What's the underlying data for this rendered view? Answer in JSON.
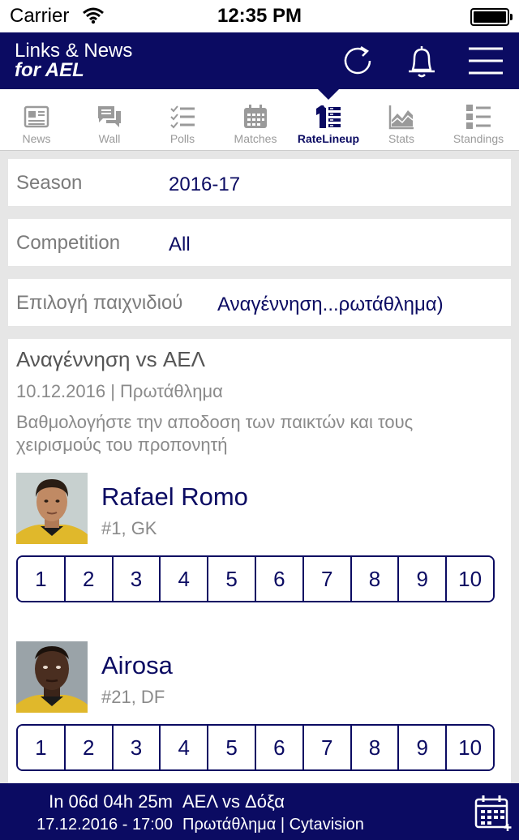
{
  "status": {
    "carrier": "Carrier",
    "time": "12:35 PM"
  },
  "nav": {
    "title_line1": "Links & News",
    "title_line2": "for AEL",
    "icons": [
      "refresh-icon",
      "bell-icon",
      "menu-icon"
    ]
  },
  "tabs": [
    {
      "label": "News",
      "icon": "news-icon",
      "active": false
    },
    {
      "label": "Wall",
      "icon": "chat-icon",
      "active": false
    },
    {
      "label": "Polls",
      "icon": "checklist-icon",
      "active": false
    },
    {
      "label": "Matches",
      "icon": "calendar-icon",
      "active": false
    },
    {
      "label": "RateLineup",
      "icon": "shirt-list-icon",
      "active": true
    },
    {
      "label": "Stats",
      "icon": "area-chart-icon",
      "active": false
    },
    {
      "label": "Standings",
      "icon": "numbered-list-icon",
      "active": false
    }
  ],
  "filters": {
    "season": {
      "label": "Season",
      "value": "2016-17"
    },
    "competition": {
      "label": "Competition",
      "value": "All"
    },
    "game": {
      "label": "Επιλογή παιχνιδιού",
      "value": "Αναγέννηση...ρωτάθλημα)"
    }
  },
  "match": {
    "title": "Αναγέννηση vs ΑΕΛ",
    "date_line": "10.12.2016 | Πρωτάθλημα",
    "description": "Βαθμολογήστε την αποδοση των παικτών και τους χειρισμούς του προπονητή"
  },
  "rating_options": [
    "1",
    "2",
    "3",
    "4",
    "5",
    "6",
    "7",
    "8",
    "9",
    "10"
  ],
  "players": [
    {
      "name": "Rafael Romo",
      "detail": "#1, GK"
    },
    {
      "name": "Airosa",
      "detail": "#21, DF"
    }
  ],
  "next_match": {
    "countdown": "In 06d 04h 25m",
    "teams": "ΑΕΛ vs Δόξα",
    "datetime": "17.12.2016 - 17:00",
    "competition_channel": "Πρωτάθλημα | Cytavision"
  },
  "colors": {
    "brand": "#0b0b62",
    "inactive_tab": "#9a9a9a",
    "background": "#e6e6e6"
  }
}
